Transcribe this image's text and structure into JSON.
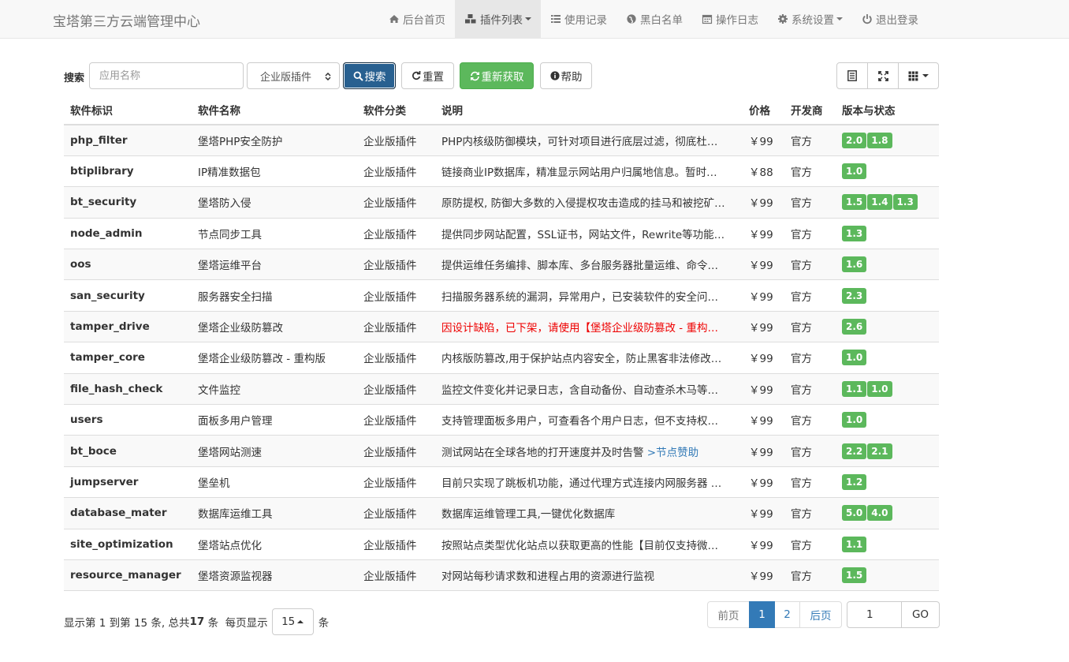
{
  "navbar": {
    "brand": "宝塔第三方云端管理中心",
    "items": [
      {
        "label": "后台首页",
        "icon": "home-icon"
      },
      {
        "label": "插件列表",
        "icon": "cubes-icon",
        "active": true,
        "dropdown": true
      },
      {
        "label": "使用记录",
        "icon": "list-icon"
      },
      {
        "label": "黑白名单",
        "icon": "globe-icon"
      },
      {
        "label": "操作日志",
        "icon": "calendar-icon"
      },
      {
        "label": "系统设置",
        "icon": "gear-icon",
        "dropdown": true
      },
      {
        "label": "退出登录",
        "icon": "power-icon"
      }
    ]
  },
  "toolbar": {
    "search_label": "搜索",
    "search_placeholder": "应用名称",
    "category_selected": "企业版插件",
    "search_button": "搜索",
    "reset_button": "重置",
    "refetch_button": "重新获取",
    "help_button": "帮助",
    "view_icons": [
      "list-view-icon",
      "fullscreen-icon",
      "grid-columns-icon"
    ]
  },
  "table": {
    "columns": [
      "软件标识",
      "软件名称",
      "软件分类",
      "说明",
      "价格",
      "开发商",
      "版本与状态"
    ],
    "rows": [
      {
        "id": "php_filter",
        "name": "堡塔PHP安全防护",
        "category": "企业版插件",
        "desc": "PHP内核级防御模块，可针对项目进行底层过滤，彻底杜…",
        "price": "￥99",
        "vendor": "官方",
        "versions": [
          "2.0",
          "1.8"
        ]
      },
      {
        "id": "btiplibrary",
        "name": "IP精准数据包",
        "category": "企业版插件",
        "desc": "链接商业IP数据库，精准显示网站用户归属地信息。暂时…",
        "price": "￥88",
        "vendor": "官方",
        "versions": [
          "1.0"
        ]
      },
      {
        "id": "bt_security",
        "name": "堡塔防入侵",
        "category": "企业版插件",
        "desc": "原防提权, 防御大多数的入侵提权攻击造成的挂马和被挖矿…",
        "price": "￥99",
        "vendor": "官方",
        "versions": [
          "1.5",
          "1.4",
          "1.3"
        ]
      },
      {
        "id": "node_admin",
        "name": "节点同步工具",
        "category": "企业版插件",
        "desc": "提供同步网站配置，SSL证书，网站文件，Rewrite等功能…",
        "price": "￥99",
        "vendor": "官方",
        "versions": [
          "1.3"
        ]
      },
      {
        "id": "oos",
        "name": "堡塔运维平台",
        "category": "企业版插件",
        "desc": "提供运维任务编排、脚本库、多台服务器批量运维、命令…",
        "price": "￥99",
        "vendor": "官方",
        "versions": [
          "1.6"
        ]
      },
      {
        "id": "san_security",
        "name": "服务器安全扫描",
        "category": "企业版插件",
        "desc": "扫描服务器系统的漏洞，异常用户，已安装软件的安全问…",
        "price": "￥99",
        "vendor": "官方",
        "versions": [
          "2.3"
        ]
      },
      {
        "id": "tamper_drive",
        "name": "堡塔企业级防篡改",
        "category": "企业版插件",
        "desc": "因设计缺陷，已下架，请使用【堡塔企业级防篡改 - 重构…",
        "desc_warn": true,
        "price": "￥99",
        "vendor": "官方",
        "versions": [
          "2.6"
        ]
      },
      {
        "id": "tamper_core",
        "name": "堡塔企业级防篡改 - 重构版",
        "category": "企业版插件",
        "desc": "内核版防篡改,用于保护站点内容安全，防止黑客非法修改…",
        "price": "￥99",
        "vendor": "官方",
        "versions": [
          "1.0"
        ]
      },
      {
        "id": "file_hash_check",
        "name": "文件监控",
        "category": "企业版插件",
        "desc": "监控文件变化并记录日志，含自动备份、自动查杀木马等…",
        "price": "￥99",
        "vendor": "官方",
        "versions": [
          "1.1",
          "1.0"
        ]
      },
      {
        "id": "users",
        "name": "面板多用户管理",
        "category": "企业版插件",
        "desc": "支持管理面板多用户，可查看各个用户日志，但不支持权…",
        "price": "￥99",
        "vendor": "官方",
        "versions": [
          "1.0"
        ]
      },
      {
        "id": "bt_boce",
        "name": "堡塔网站测速",
        "category": "企业版插件",
        "desc": "测试网站在全球各地的打开速度并及时告警 ",
        "desc_link": ">节点赞助",
        "price": "￥99",
        "vendor": "官方",
        "versions": [
          "2.2",
          "2.1"
        ]
      },
      {
        "id": "jumpserver",
        "name": "堡垒机",
        "category": "企业版插件",
        "desc": "目前只实现了跳板机功能，通过代理方式连接内网服务器 …",
        "price": "￥99",
        "vendor": "官方",
        "versions": [
          "1.2"
        ]
      },
      {
        "id": "database_mater",
        "name": "数据库运维工具",
        "category": "企业版插件",
        "desc": "数据库运维管理工具,一键优化数据库",
        "price": "￥99",
        "vendor": "官方",
        "versions": [
          "5.0",
          "4.0"
        ]
      },
      {
        "id": "site_optimization",
        "name": "堡塔站点优化",
        "category": "企业版插件",
        "desc": "按照站点类型优化站点以获取更高的性能【目前仅支持微…",
        "price": "￥99",
        "vendor": "官方",
        "versions": [
          "1.1"
        ]
      },
      {
        "id": "resource_manager",
        "name": "堡塔资源监视器",
        "category": "企业版插件",
        "desc": "对网站每秒请求数和进程占用的资源进行监视",
        "price": "￥99",
        "vendor": "官方",
        "versions": [
          "1.5"
        ]
      }
    ]
  },
  "pagination": {
    "info_prefix": "显示第 1 到第 15 条, 总共 ",
    "total": "17",
    "info_suffix": " 条  每页显示",
    "page_size": "15",
    "unit": "条",
    "prev": "前页",
    "pages": [
      "1",
      "2"
    ],
    "current_page": "1",
    "next": "后页",
    "go_value": "1",
    "go_button": "GO"
  }
}
